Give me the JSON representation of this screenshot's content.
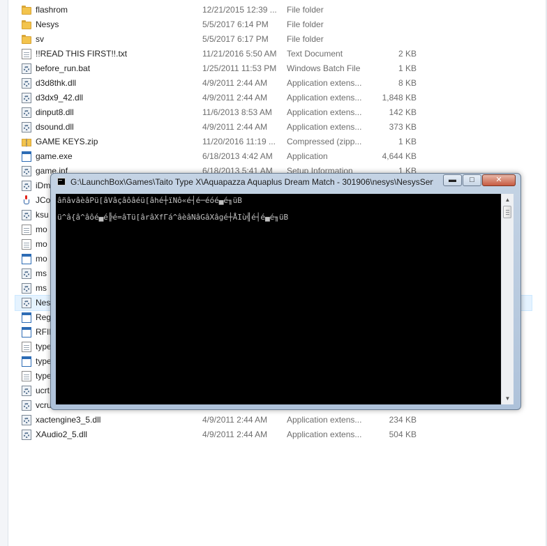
{
  "files": [
    {
      "name": "flashrom",
      "date": "12/21/2015 12:39 ...",
      "type": "File folder",
      "size": "",
      "icon": "folder-icon"
    },
    {
      "name": "Nesys",
      "date": "5/5/2017 6:14 PM",
      "type": "File folder",
      "size": "",
      "icon": "folder-icon"
    },
    {
      "name": "sv",
      "date": "5/5/2017 6:17 PM",
      "type": "File folder",
      "size": "",
      "icon": "folder-icon"
    },
    {
      "name": "!!READ THIS FIRST!!.txt",
      "date": "11/21/2016 5:50 AM",
      "type": "Text Document",
      "size": "2 KB",
      "icon": "text-document-icon"
    },
    {
      "name": "before_run.bat",
      "date": "1/25/2011 11:53 PM",
      "type": "Windows Batch File",
      "size": "1 KB",
      "icon": "batch-file-icon"
    },
    {
      "name": "d3d8thk.dll",
      "date": "4/9/2011 2:44 AM",
      "type": "Application extens...",
      "size": "8 KB",
      "icon": "dll-file-icon"
    },
    {
      "name": "d3dx9_42.dll",
      "date": "4/9/2011 2:44 AM",
      "type": "Application extens...",
      "size": "1,848 KB",
      "icon": "dll-file-icon"
    },
    {
      "name": "dinput8.dll",
      "date": "11/6/2013 8:53 AM",
      "type": "Application extens...",
      "size": "142 KB",
      "icon": "dll-file-icon"
    },
    {
      "name": "dsound.dll",
      "date": "4/9/2011 2:44 AM",
      "type": "Application extens...",
      "size": "373 KB",
      "icon": "dll-file-icon"
    },
    {
      "name": "GAME KEYS.zip",
      "date": "11/20/2016 11:19 ...",
      "type": "Compressed (zipp...",
      "size": "1 KB",
      "icon": "zip-folder-icon"
    },
    {
      "name": "game.exe",
      "date": "6/18/2013 4:42 AM",
      "type": "Application",
      "size": "4,644 KB",
      "icon": "application-icon"
    },
    {
      "name": "game.inf",
      "date": "6/18/2013 5:41 AM",
      "type": "Setup Information",
      "size": "1 KB",
      "icon": "setup-info-icon"
    },
    {
      "name": "iDm",
      "date": "",
      "type": "",
      "size": "",
      "icon": "dll-file-icon"
    },
    {
      "name": "JCo",
      "date": "",
      "type": "",
      "size": "",
      "icon": "java-icon"
    },
    {
      "name": "ksu",
      "date": "",
      "type": "",
      "size": "",
      "icon": "dll-file-icon"
    },
    {
      "name": "mo",
      "date": "",
      "type": "",
      "size": "",
      "icon": "blank-file-icon"
    },
    {
      "name": "mo",
      "date": "",
      "type": "",
      "size": "",
      "icon": "blank-file-icon"
    },
    {
      "name": "mo",
      "date": "",
      "type": "",
      "size": "",
      "icon": "media-file-icon"
    },
    {
      "name": "ms",
      "date": "",
      "type": "",
      "size": "",
      "icon": "dll-file-icon"
    },
    {
      "name": "ms",
      "date": "",
      "type": "",
      "size": "",
      "icon": "dll-file-icon"
    },
    {
      "name": "Nes",
      "date": "",
      "type": "",
      "size": "",
      "icon": "dll-file-icon"
    },
    {
      "name": "Reg",
      "date": "",
      "type": "",
      "size": "",
      "icon": "registry-file-icon"
    },
    {
      "name": "RFID",
      "date": "",
      "type": "",
      "size": "",
      "icon": "application-icon"
    },
    {
      "name": "type",
      "date": "",
      "type": "",
      "size": "",
      "icon": "blank-file-icon"
    },
    {
      "name": "type",
      "date": "",
      "type": "",
      "size": "",
      "icon": "application-icon"
    },
    {
      "name": "type",
      "date": "",
      "type": "",
      "size": "",
      "icon": "blank-file-icon"
    },
    {
      "name": "ucrt",
      "date": "",
      "type": "",
      "size": "",
      "icon": "dll-file-icon"
    },
    {
      "name": "vcru",
      "date": "",
      "type": "",
      "size": "",
      "icon": "dll-file-icon"
    },
    {
      "name": "xactengine3_5.dll",
      "date": "4/9/2011 2:44 AM",
      "type": "Application extens...",
      "size": "234 KB",
      "icon": "dll-file-icon"
    },
    {
      "name": "XAudio2_5.dll",
      "date": "4/9/2011 2:44 AM",
      "type": "Application extens...",
      "size": "504 KB",
      "icon": "dll-file-icon"
    }
  ],
  "console": {
    "title": "G:\\LaunchBox\\Games\\Taito Type X\\Aquapazza Aquaplus Dream Match - 301906\\nesys\\NesysServi...",
    "minimize_label": "▬",
    "maximize_label": "□",
    "close_label": "✕",
    "lines": [
      "âñâvâèâPü[âVâçâôâéü[âhé┼ïNô«é┤é─éóé▄é╖üB",
      "ü^â{â^âôé▄é╠é=âTü[ârâXfΓá^âèâNâGâXâgé┼ÅIù╣é┤é▄é╖üB"
    ]
  }
}
